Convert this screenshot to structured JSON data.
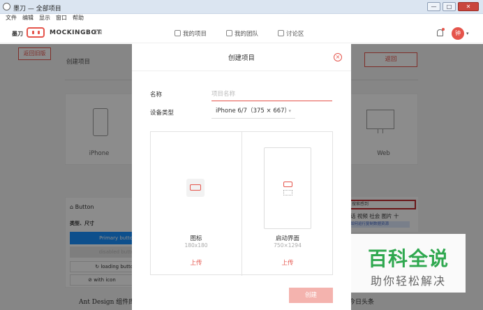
{
  "window": {
    "title": "墨刀 — 全部项目",
    "btn_min": "—",
    "btn_max": "□",
    "btn_close": "✕"
  },
  "menu": [
    "文件",
    "编辑",
    "显示",
    "窗口",
    "帮助"
  ],
  "header": {
    "logo_cn": "墨刀",
    "logo_text": "MOCKINGBOT",
    "lang": "EN",
    "nav": [
      "我的项目",
      "我的团队",
      "讨论区"
    ],
    "avatar": "钟",
    "avatar_caret": "▾"
  },
  "background": {
    "back_old": "返回旧版",
    "create_project": "创建项目",
    "back": "返回",
    "iphone_label": "iPhone",
    "web_label": "Web",
    "button_panel": {
      "title": "Button",
      "subtitle": "类型、尺寸",
      "primary": "Primary butto",
      "disabled": "disabled butto",
      "loading": "loading butto",
      "with_icon": "with icon"
    },
    "ant_design": "Ant Design 组件库",
    "right_panel": {
      "search": "搜索感到",
      "tabs": "话  视频  社会  图片  十",
      "blue_text": "如何运行复制数据资源"
    },
    "toutiao": "今日头条"
  },
  "modal": {
    "title": "创建项目",
    "close_glyph": "×",
    "name_label": "名称",
    "name_placeholder": "项目名称",
    "name_value": "",
    "device_label": "设备类型",
    "device_value": "iPhone 6/7（375 × 667）",
    "upload_icon": {
      "title": "图标",
      "size": "180x180",
      "action": "上传"
    },
    "upload_splash": {
      "title": "启动界面",
      "size": "750×1294",
      "action": "上传"
    },
    "create_button": "创建"
  },
  "watermark": {
    "main": "百科全说",
    "sub": "助你轻松解决"
  },
  "colors": {
    "accent": "#e5544b",
    "primary_blue": "#1890ff",
    "watermark_green": "#2fa84f"
  }
}
